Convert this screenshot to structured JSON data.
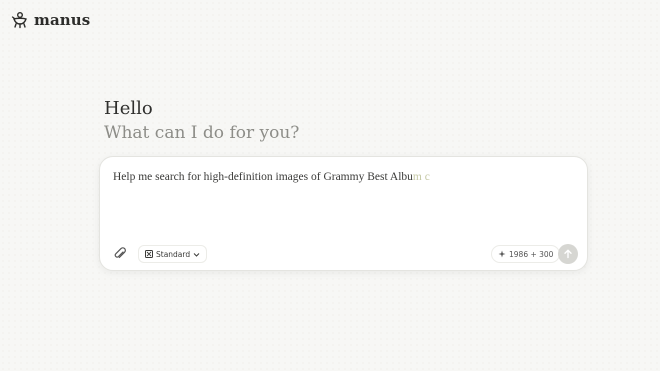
{
  "brand": {
    "name": "manus",
    "logo_icon": "manus-logo-icon"
  },
  "greeting": {
    "title": "Hello",
    "subtitle": "What can I do for you?"
  },
  "composer": {
    "input_text": "Help me search for high-definition images of Grammy Best Albu",
    "input_text_streaming": "m c",
    "attach_icon": "paperclip-icon",
    "mode": {
      "label": "Standard",
      "icon": "mode-icon",
      "chevron_icon": "chevron-down-icon"
    },
    "credits": {
      "label": "1986 + 300",
      "icon": "sparkle-icon"
    },
    "send_icon": "arrow-up-icon"
  },
  "colors": {
    "background": "#f7f7f5",
    "text": "#2f2f2d",
    "muted_text": "#8d8d88",
    "send_disabled": "#d6d6d2"
  }
}
